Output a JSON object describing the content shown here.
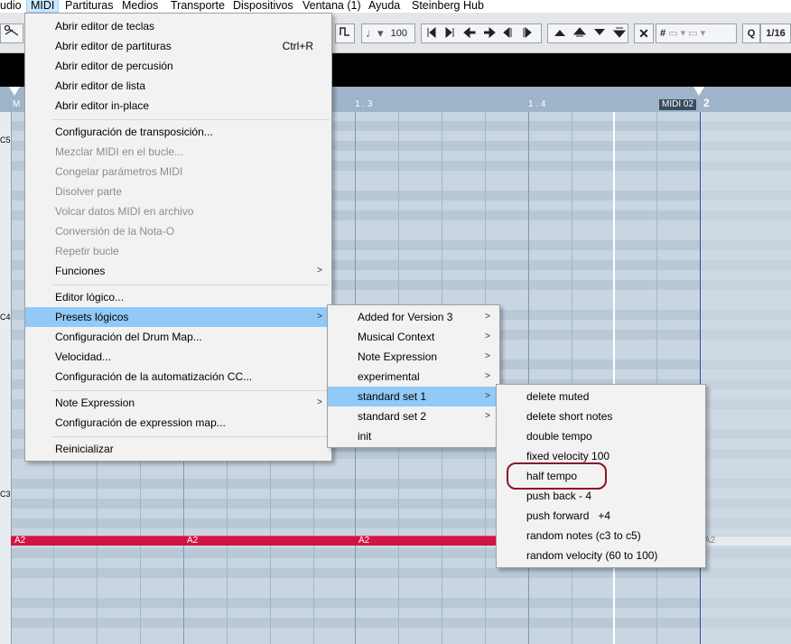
{
  "menubar": {
    "items": [
      "udio",
      "MIDI",
      "Partituras",
      "Medios",
      "Transporte",
      "Dispositivos",
      "Ventana (1)",
      "Ayuda",
      "Steinberg Hub"
    ]
  },
  "toolbar": {
    "velocity": "100",
    "quantize_label": "Q",
    "quantize_value": "1/16"
  },
  "ruler": {
    "marks": [
      "1 . 3",
      "1 . 4"
    ],
    "part_name": "MIDI 02",
    "bar_number": "2",
    "left_cut_label": "M"
  },
  "keys": {
    "labels": [
      "C5",
      "C4",
      "C3"
    ]
  },
  "notes": {
    "label": "A2"
  },
  "midi_menu": {
    "items": [
      {
        "label": "Abrir editor de teclas",
        "state": "enabled"
      },
      {
        "label": "Abrir editor de partituras",
        "shortcut": "Ctrl+R",
        "state": "enabled"
      },
      {
        "label": "Abrir editor de percusión",
        "state": "enabled"
      },
      {
        "label": "Abrir editor de lista",
        "state": "enabled"
      },
      {
        "label": "Abrir editor in-place",
        "state": "enabled"
      },
      {
        "label": "Configuración de transposición...",
        "state": "enabled"
      },
      {
        "label": "Mezclar MIDI en el bucle...",
        "state": "disabled"
      },
      {
        "label": "Congelar parámetros MIDI",
        "state": "disabled"
      },
      {
        "label": "Disolver parte",
        "state": "disabled"
      },
      {
        "label": "Volcar datos MIDI en archivo",
        "state": "disabled"
      },
      {
        "label": "Conversión de la Nota-O",
        "state": "disabled"
      },
      {
        "label": "Repetir bucle",
        "state": "disabled"
      },
      {
        "label": "Funciones",
        "state": "enabled",
        "submenu": true
      },
      {
        "label": "Editor lógico...",
        "state": "enabled"
      },
      {
        "label": "Presets lógicos",
        "state": "highlighted",
        "submenu": true
      },
      {
        "label": "Configuración del Drum Map...",
        "state": "enabled"
      },
      {
        "label": "Velocidad...",
        "state": "enabled"
      },
      {
        "label": "Configuración de la automatización CC...",
        "state": "enabled"
      },
      {
        "label": "Note Expression",
        "state": "enabled",
        "submenu": true
      },
      {
        "label": "Configuración de expression map...",
        "state": "enabled"
      },
      {
        "label": "Reinicializar",
        "state": "enabled"
      }
    ]
  },
  "presets_menu": {
    "items": [
      {
        "label": "Added for Version 3",
        "submenu": true
      },
      {
        "label": "Musical Context",
        "submenu": true
      },
      {
        "label": "Note Expression",
        "submenu": true
      },
      {
        "label": "experimental",
        "submenu": true
      },
      {
        "label": "standard set 1",
        "submenu": true,
        "state": "highlighted"
      },
      {
        "label": "standard set 2",
        "submenu": true
      },
      {
        "label": "init"
      }
    ]
  },
  "standard_set_menu": {
    "items": [
      {
        "label": "delete muted"
      },
      {
        "label": "delete short notes"
      },
      {
        "label": "double tempo"
      },
      {
        "label": "fixed velocity 100"
      },
      {
        "label": "half tempo",
        "state": "circled"
      },
      {
        "label": "push back - 4"
      },
      {
        "label": "push forward   +4"
      },
      {
        "label": "random notes (c3 to c5)"
      },
      {
        "label": "random velocity (60 to 100)"
      }
    ]
  },
  "colors": {
    "menu_highlight": "#91c9f7",
    "note_red": "#d11442",
    "annotation_ring": "#8b1228"
  }
}
